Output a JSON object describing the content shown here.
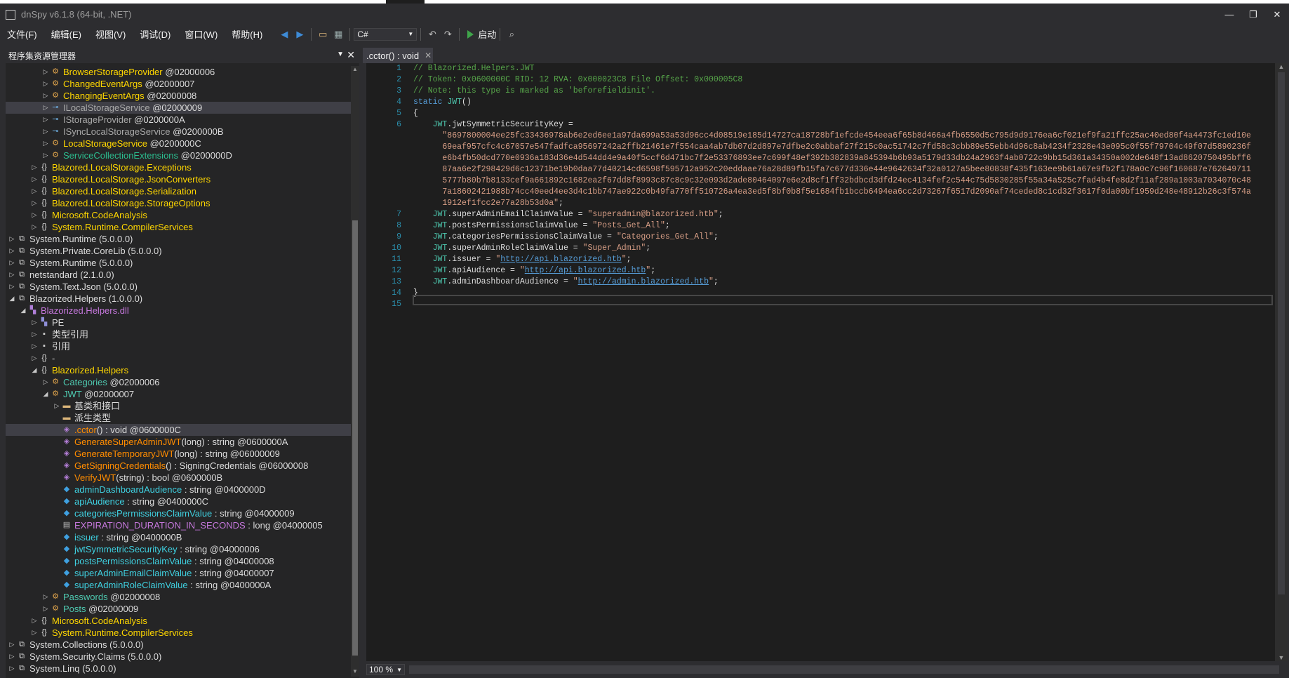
{
  "window": {
    "title": "dnSpy v6.1.8 (64-bit, .NET)",
    "minimize": "—",
    "maximize": "❐",
    "close": "✕"
  },
  "menu": [
    "文件(F)",
    "编辑(E)",
    "视图(V)",
    "调试(D)",
    "窗口(W)",
    "帮助(H)"
  ],
  "toolbar": {
    "language": "C#",
    "run_label": "启动"
  },
  "left_panel": {
    "title": "程序集资源管理器"
  },
  "tree": [
    {
      "depth": 4,
      "exp": "closed",
      "icon": "class-icon",
      "text": "BrowserStorageProvider",
      "suffix": " @02000006",
      "color": "yellow"
    },
    {
      "depth": 4,
      "exp": "closed",
      "icon": "class-icon",
      "text": "ChangedEventArgs",
      "suffix": " @02000007",
      "color": "yellow"
    },
    {
      "depth": 4,
      "exp": "closed",
      "icon": "class-icon",
      "text": "ChangingEventArgs",
      "suffix": " @02000008",
      "color": "yellow"
    },
    {
      "depth": 4,
      "exp": "closed",
      "icon": "interface-icon",
      "text": "ILocalStorageService",
      "suffix": " @02000009",
      "color": "gray",
      "selected": true
    },
    {
      "depth": 4,
      "exp": "closed",
      "icon": "interface-icon",
      "text": "IStorageProvider",
      "suffix": " @0200000A",
      "color": "gray"
    },
    {
      "depth": 4,
      "exp": "closed",
      "icon": "interface-icon",
      "text": "ISyncLocalStorageService",
      "suffix": " @0200000B",
      "color": "gray"
    },
    {
      "depth": 4,
      "exp": "closed",
      "icon": "class-icon",
      "text": "LocalStorageService",
      "suffix": " @0200000C",
      "color": "yellow"
    },
    {
      "depth": 4,
      "exp": "closed",
      "icon": "class-icon",
      "text": "ServiceCollectionExtensions",
      "suffix": " @0200000D",
      "color": "green"
    },
    {
      "depth": 3,
      "exp": "closed",
      "icon": "namespace-icon",
      "text": "Blazored.LocalStorage.Exceptions",
      "suffix": "",
      "color": "yellow"
    },
    {
      "depth": 3,
      "exp": "closed",
      "icon": "namespace-icon",
      "text": "Blazored.LocalStorage.JsonConverters",
      "suffix": "",
      "color": "yellow"
    },
    {
      "depth": 3,
      "exp": "closed",
      "icon": "namespace-icon",
      "text": "Blazored.LocalStorage.Serialization",
      "suffix": "",
      "color": "yellow"
    },
    {
      "depth": 3,
      "exp": "closed",
      "icon": "namespace-icon",
      "text": "Blazored.LocalStorage.StorageOptions",
      "suffix": "",
      "color": "yellow"
    },
    {
      "depth": 3,
      "exp": "closed",
      "icon": "namespace-icon",
      "text": "Microsoft.CodeAnalysis",
      "suffix": "",
      "color": "yellow"
    },
    {
      "depth": 3,
      "exp": "closed",
      "icon": "namespace-icon",
      "text": "System.Runtime.CompilerServices",
      "suffix": "",
      "color": "yellow"
    },
    {
      "depth": 1,
      "exp": "closed",
      "icon": "assembly-icon",
      "text": "System.Runtime (5.0.0.0)",
      "suffix": "",
      "color": "white"
    },
    {
      "depth": 1,
      "exp": "closed",
      "icon": "assembly-icon",
      "text": "System.Private.CoreLib (5.0.0.0)",
      "suffix": "",
      "color": "white"
    },
    {
      "depth": 1,
      "exp": "closed",
      "icon": "assembly-icon",
      "text": "System.Runtime (5.0.0.0)",
      "suffix": "",
      "color": "white"
    },
    {
      "depth": 1,
      "exp": "closed",
      "icon": "assembly-icon",
      "text": "netstandard (2.1.0.0)",
      "suffix": "",
      "color": "white"
    },
    {
      "depth": 1,
      "exp": "closed",
      "icon": "assembly-icon",
      "text": "System.Text.Json (5.0.0.0)",
      "suffix": "",
      "color": "white"
    },
    {
      "depth": 1,
      "exp": "open",
      "icon": "assembly-icon",
      "text": "Blazorized.Helpers (1.0.0.0)",
      "suffix": "",
      "color": "white"
    },
    {
      "depth": 2,
      "exp": "open",
      "icon": "module-icon",
      "text": "Blazorized.Helpers.dll",
      "suffix": "",
      "color": "purple"
    },
    {
      "depth": 3,
      "exp": "closed",
      "icon": "pe-icon",
      "text": "PE",
      "suffix": "",
      "color": "white"
    },
    {
      "depth": 3,
      "exp": "closed",
      "icon": "typeref-icon",
      "text": "类型引用",
      "suffix": "",
      "color": "white"
    },
    {
      "depth": 3,
      "exp": "closed",
      "icon": "reference-icon",
      "text": "引用",
      "suffix": "",
      "color": "white"
    },
    {
      "depth": 3,
      "exp": "closed",
      "icon": "namespace-icon",
      "text": "-",
      "suffix": "",
      "color": "white"
    },
    {
      "depth": 3,
      "exp": "open",
      "icon": "namespace-icon",
      "text": "Blazorized.Helpers",
      "suffix": "",
      "color": "yellow"
    },
    {
      "depth": 4,
      "exp": "closed",
      "icon": "class-icon",
      "text": "Categories",
      "suffix": " @02000006",
      "color": "teal"
    },
    {
      "depth": 4,
      "exp": "open",
      "icon": "class-icon",
      "text": "JWT",
      "suffix": " @02000007",
      "color": "teal"
    },
    {
      "depth": 5,
      "exp": "closed",
      "icon": "folder-icon",
      "text": "基类和接口",
      "suffix": "",
      "color": "white"
    },
    {
      "depth": 5,
      "exp": "none",
      "icon": "folder-icon",
      "text": "派生类型",
      "suffix": "",
      "color": "white"
    },
    {
      "depth": 5,
      "exp": "none",
      "icon": "method-icon",
      "text": ".cctor",
      "suffix": "() : void @0600000C",
      "color": "orange",
      "selected": true
    },
    {
      "depth": 5,
      "exp": "none",
      "icon": "method-icon",
      "text": "GenerateSuperAdminJWT",
      "suffix": "(long) : string @0600000A",
      "color": "orange"
    },
    {
      "depth": 5,
      "exp": "none",
      "icon": "method-icon",
      "text": "GenerateTemporaryJWT",
      "suffix": "(long) : string @06000009",
      "color": "orange"
    },
    {
      "depth": 5,
      "exp": "none",
      "icon": "method-icon",
      "text": "GetSigningCredentials",
      "suffix": "() : SigningCredentials @06000008",
      "color": "orange"
    },
    {
      "depth": 5,
      "exp": "none",
      "icon": "method-icon",
      "text": "VerifyJWT",
      "suffix": "(string) : bool @0600000B",
      "color": "orange"
    },
    {
      "depth": 5,
      "exp": "none",
      "icon": "field-icon",
      "text": "adminDashboardAudience",
      "suffix": " : string @0400000D",
      "color": "cyan"
    },
    {
      "depth": 5,
      "exp": "none",
      "icon": "field-icon",
      "text": "apiAudience",
      "suffix": " : string @0400000C",
      "color": "cyan"
    },
    {
      "depth": 5,
      "exp": "none",
      "icon": "field-icon",
      "text": "categoriesPermissionsClaimValue",
      "suffix": " : string @04000009",
      "color": "cyan"
    },
    {
      "depth": 5,
      "exp": "none",
      "icon": "const-icon",
      "text": "EXPIRATION_DURATION_IN_SECONDS",
      "suffix": " : long @04000005",
      "color": "purple"
    },
    {
      "depth": 5,
      "exp": "none",
      "icon": "field-icon",
      "text": "issuer",
      "suffix": " : string @0400000B",
      "color": "cyan"
    },
    {
      "depth": 5,
      "exp": "none",
      "icon": "field-icon",
      "text": "jwtSymmetricSecurityKey",
      "suffix": " : string @04000006",
      "color": "cyan"
    },
    {
      "depth": 5,
      "exp": "none",
      "icon": "field-icon",
      "text": "postsPermissionsClaimValue",
      "suffix": " : string @04000008",
      "color": "cyan"
    },
    {
      "depth": 5,
      "exp": "none",
      "icon": "field-icon",
      "text": "superAdminEmailClaimValue",
      "suffix": " : string @04000007",
      "color": "cyan"
    },
    {
      "depth": 5,
      "exp": "none",
      "icon": "field-icon",
      "text": "superAdminRoleClaimValue",
      "suffix": " : string @0400000A",
      "color": "cyan"
    },
    {
      "depth": 4,
      "exp": "closed",
      "icon": "class-icon",
      "text": "Passwords",
      "suffix": " @02000008",
      "color": "teal"
    },
    {
      "depth": 4,
      "exp": "closed",
      "icon": "class-icon",
      "text": "Posts",
      "suffix": " @02000009",
      "color": "teal"
    },
    {
      "depth": 3,
      "exp": "closed",
      "icon": "namespace-icon",
      "text": "Microsoft.CodeAnalysis",
      "suffix": "",
      "color": "yellow"
    },
    {
      "depth": 3,
      "exp": "closed",
      "icon": "namespace-icon",
      "text": "System.Runtime.CompilerServices",
      "suffix": "",
      "color": "yellow"
    },
    {
      "depth": 1,
      "exp": "closed",
      "icon": "assembly-icon",
      "text": "System.Collections (5.0.0.0)",
      "suffix": "",
      "color": "white"
    },
    {
      "depth": 1,
      "exp": "closed",
      "icon": "assembly-icon",
      "text": "System.Security.Claims (5.0.0.0)",
      "suffix": "",
      "color": "white"
    },
    {
      "depth": 1,
      "exp": "closed",
      "icon": "assembly-icon",
      "text": "System.Linq (5.0.0.0)",
      "suffix": "",
      "color": "white"
    }
  ],
  "editor": {
    "tab_title": ".cctor() : void",
    "zoom": "100 %",
    "lines": [
      {
        "n": "1",
        "segs": [
          {
            "t": "// Blazorized.Helpers.JWT",
            "c": "cm"
          }
        ]
      },
      {
        "n": "2",
        "segs": [
          {
            "t": "// Token: 0x0600000C RID: 12 RVA: 0x000023C8 File Offset: 0x000005C8",
            "c": "cm"
          }
        ]
      },
      {
        "n": "3",
        "segs": [
          {
            "t": "// Note: this type is marked as 'beforefieldinit'.",
            "c": "cm"
          }
        ]
      },
      {
        "n": "4",
        "segs": [
          {
            "t": "static ",
            "c": "kw"
          },
          {
            "t": "JWT",
            "c": "c-teal"
          },
          {
            "t": "()",
            "c": ""
          }
        ]
      },
      {
        "n": "5",
        "segs": [
          {
            "t": "{",
            "c": ""
          }
        ]
      },
      {
        "n": "6",
        "segs": [
          {
            "t": "    JWT",
            "c": "c-teal"
          },
          {
            "t": ".jwtSymmetricSecurityKey = ",
            "c": ""
          }
        ]
      },
      {
        "n": "",
        "segs": [
          {
            "t": "      \"8697800004ee25fc33436978ab6e2ed6ee1a97da699a53a53d96cc4d08519e185d14727ca18728bf1efcde454eea6f65b8d466a4fb6550d5c795d9d9176ea6cf021ef9fa21ffc25ac40ed80f4a4473fc1ed10e",
            "c": "str"
          }
        ]
      },
      {
        "n": "",
        "segs": [
          {
            "t": "      69eaf957cfc4c67057e547fadfca95697242a2ffb21461e7f554caa4ab7db07d2d897e7dfbe2c0abbaf27f215c0ac51742c7fd58c3cbb89e55ebb4d96c8ab4234f2328e43e095c0f55f79704c49f07d5890236f",
            "c": "str"
          }
        ]
      },
      {
        "n": "",
        "segs": [
          {
            "t": "      e6b4fb50dcd770e0936a183d36e4d544dd4e9a40f5ccf6d471bc7f2e53376893ee7c699f48ef392b382839a845394b6b93a5179d33db24a2963f4ab0722c9bb15d361a34350a002de648f13ad8620750495bff6",
            "c": "str"
          }
        ]
      },
      {
        "n": "",
        "segs": [
          {
            "t": "      87aa6e2f298429d6c12371be19b0daa77d40214cd6598f595712a952c20eddaae76a28d89fb15fa7c677d336e44e9642634f32a0127a5bee80838f435f163ee9b61a67e9fb2f178a0c7c96f160687e762649711",
            "c": "str"
          }
        ]
      },
      {
        "n": "",
        "segs": [
          {
            "t": "      5777b80b7b8133cef9a661892c1682ea2f67dd8f8993c87c8c9c32e093d2ade80464097e6e2d8cf1ff32bdbcd3dfd24ec4134fef2c544c75d5830285f55a34a525c7fad4b4fe8d2f11af289a1003a7034070c48",
            "c": "str"
          }
        ]
      },
      {
        "n": "",
        "segs": [
          {
            "t": "      7a18602421988b74cc40eed4ee3d4c1bb747ae922c0b49fa770ff510726a4ea3ed5f8bf0b8f5e1684fb1bccb6494ea6cc2d73267f6517d2090af74ceded8c1cd32f3617f0da00bf1959d248e48912b26c3f574a",
            "c": "str"
          }
        ]
      },
      {
        "n": "",
        "segs": [
          {
            "t": "      1912ef1fcc2e77a28b53d0a\"",
            "c": "str"
          },
          {
            "t": ";",
            "c": ""
          }
        ]
      },
      {
        "n": "7",
        "segs": [
          {
            "t": "    JWT",
            "c": "c-teal"
          },
          {
            "t": ".superAdminEmailClaimValue = ",
            "c": ""
          },
          {
            "t": "\"superadmin@blazorized.htb\"",
            "c": "str"
          },
          {
            "t": ";",
            "c": ""
          }
        ]
      },
      {
        "n": "8",
        "segs": [
          {
            "t": "    JWT",
            "c": "c-teal"
          },
          {
            "t": ".postsPermissionsClaimValue = ",
            "c": ""
          },
          {
            "t": "\"Posts_Get_All\"",
            "c": "str"
          },
          {
            "t": ";",
            "c": ""
          }
        ]
      },
      {
        "n": "9",
        "segs": [
          {
            "t": "    JWT",
            "c": "c-teal"
          },
          {
            "t": ".categoriesPermissionsClaimValue = ",
            "c": ""
          },
          {
            "t": "\"Categories_Get_All\"",
            "c": "str"
          },
          {
            "t": ";",
            "c": ""
          }
        ]
      },
      {
        "n": "10",
        "segs": [
          {
            "t": "    JWT",
            "c": "c-teal"
          },
          {
            "t": ".superAdminRoleClaimValue = ",
            "c": ""
          },
          {
            "t": "\"Super_Admin\"",
            "c": "str"
          },
          {
            "t": ";",
            "c": ""
          }
        ]
      },
      {
        "n": "11",
        "segs": [
          {
            "t": "    JWT",
            "c": "c-teal"
          },
          {
            "t": ".issuer = ",
            "c": ""
          },
          {
            "t": "\"",
            "c": "str"
          },
          {
            "t": "http://api.blazorized.htb",
            "c": "link"
          },
          {
            "t": "\"",
            "c": "str"
          },
          {
            "t": ";",
            "c": ""
          }
        ]
      },
      {
        "n": "12",
        "segs": [
          {
            "t": "    JWT",
            "c": "c-teal"
          },
          {
            "t": ".apiAudience = ",
            "c": ""
          },
          {
            "t": "\"",
            "c": "str"
          },
          {
            "t": "http://api.blazorized.htb",
            "c": "link"
          },
          {
            "t": "\"",
            "c": "str"
          },
          {
            "t": ";",
            "c": ""
          }
        ]
      },
      {
        "n": "13",
        "segs": [
          {
            "t": "    JWT",
            "c": "c-teal"
          },
          {
            "t": ".adminDashboardAudience = ",
            "c": ""
          },
          {
            "t": "\"",
            "c": "str"
          },
          {
            "t": "http://admin.blazorized.htb",
            "c": "link"
          },
          {
            "t": "\"",
            "c": "str"
          },
          {
            "t": ";",
            "c": ""
          }
        ]
      },
      {
        "n": "14",
        "segs": [
          {
            "t": "}",
            "c": ""
          }
        ]
      },
      {
        "n": "15",
        "segs": [
          {
            "t": "",
            "c": ""
          }
        ]
      }
    ]
  }
}
